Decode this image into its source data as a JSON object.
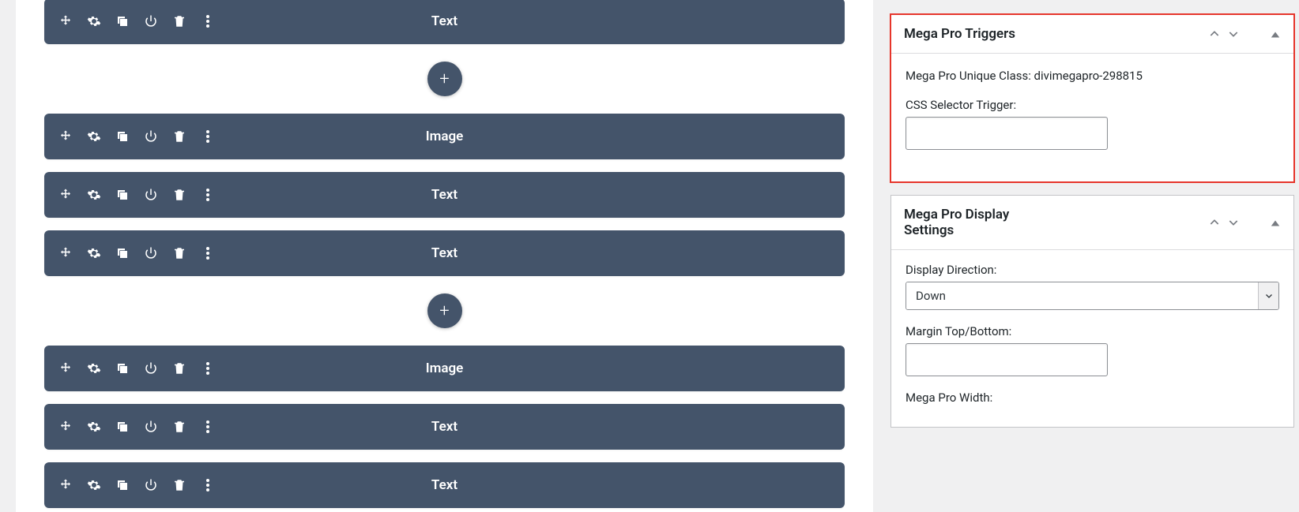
{
  "editor": {
    "groups": [
      {
        "modules": [
          {
            "label": "Text"
          }
        ],
        "show_add": true
      },
      {
        "modules": [
          {
            "label": "Image"
          },
          {
            "label": "Text"
          },
          {
            "label": "Text"
          }
        ],
        "show_add": true
      },
      {
        "modules": [
          {
            "label": "Image"
          },
          {
            "label": "Text"
          },
          {
            "label": "Text"
          }
        ],
        "show_add": false
      }
    ],
    "add_symbol": "+"
  },
  "sidebar": {
    "panel1": {
      "title": "Mega Pro Triggers",
      "unique_class_label": "Mega Pro Unique Class: divimegapro-298815",
      "css_selector_label": "CSS Selector Trigger:",
      "css_selector_value": ""
    },
    "panel2": {
      "title": "Mega Pro Display Settings",
      "display_direction_label": "Display Direction:",
      "display_direction_value": "Down",
      "margin_label": "Margin Top/Bottom:",
      "margin_value": "",
      "width_label": "Mega Pro Width:"
    }
  }
}
